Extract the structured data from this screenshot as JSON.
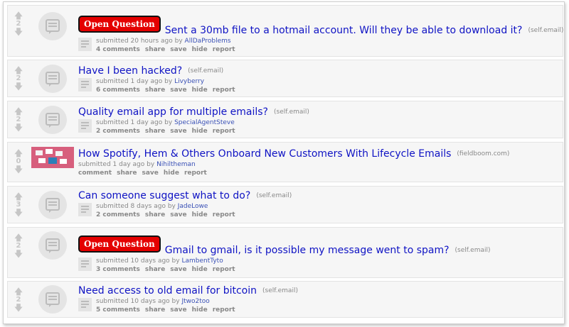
{
  "posts": [
    {
      "score": "2",
      "badge": "Open Question",
      "title": "Sent a 30mb file to a hotmail account. Will they be able to download it?",
      "domain": "(self.email)",
      "submitted_prefix": "submitted 20 hours ago by",
      "author": "AllDaProblems",
      "comments": "4 comments",
      "share": "share",
      "save": "save",
      "hide": "hide",
      "report": "report"
    },
    {
      "score": "2",
      "title": "Have I been hacked?",
      "domain": "(self.email)",
      "submitted_prefix": "submitted 1 day ago by",
      "author": "Livyberry",
      "comments": "6 comments",
      "share": "share",
      "save": "save",
      "hide": "hide",
      "report": "report"
    },
    {
      "score": "2",
      "title": "Quality email app for multiple emails?",
      "domain": "(self.email)",
      "submitted_prefix": "submitted 1 day ago by",
      "author": "SpecialAgentSteve",
      "comments": "2 comments",
      "share": "share",
      "save": "save",
      "hide": "hide",
      "report": "report"
    },
    {
      "score": "0",
      "title": "How Spotify, Hem & Others Onboard New Customers With Lifecycle Emails",
      "domain": "(fieldboom.com)",
      "submitted_prefix": "submitted 1 day ago by",
      "author": "Nihiltheman",
      "comments": "comment",
      "share": "share",
      "save": "save",
      "hide": "hide",
      "report": "report"
    },
    {
      "score": "3",
      "title": "Can someone suggest what to do?",
      "domain": "(self.email)",
      "submitted_prefix": "submitted 8 days ago by",
      "author": "JadeLowe",
      "comments": "2 comments",
      "share": "share",
      "save": "save",
      "hide": "hide",
      "report": "report"
    },
    {
      "score": "2",
      "badge": "Open Question",
      "title": "Gmail to gmail, is it possible my message went to spam?",
      "domain": "(self.email)",
      "submitted_prefix": "submitted 10 days ago by",
      "author": "LambentTyto",
      "comments": "3 comments",
      "share": "share",
      "save": "save",
      "hide": "hide",
      "report": "report"
    },
    {
      "score": "2",
      "title": "Need access to old email for bitcoin",
      "domain": "(self.email)",
      "submitted_prefix": "submitted 10 days ago by",
      "author": "Jtwo2too",
      "comments": "5 comments",
      "share": "share",
      "save": "save",
      "hide": "hide",
      "report": "report"
    }
  ],
  "icons": {
    "upvote": "upvote-arrow-icon",
    "downvote": "downvote-arrow-icon",
    "self_thumb": "speech-bubble-icon",
    "text_post": "text-post-icon"
  },
  "colors": {
    "title_link": "#0f13c4",
    "author_link": "#3a51b6",
    "badge": "#e40000",
    "muted": "#888888"
  }
}
